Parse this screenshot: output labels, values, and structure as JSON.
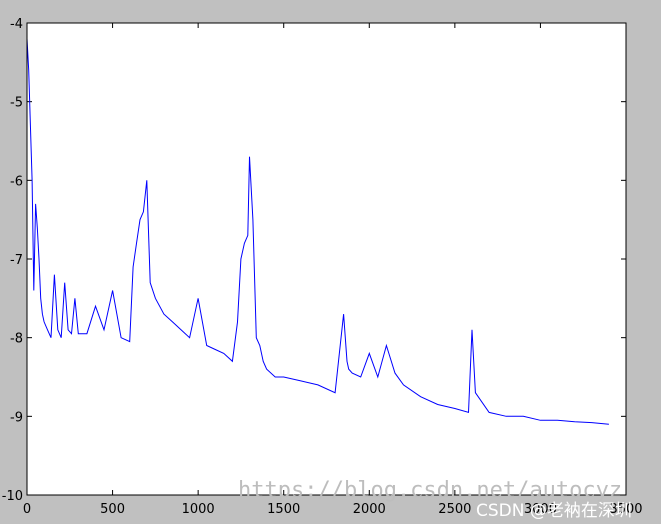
{
  "chart_data": {
    "type": "line",
    "xlim": [
      0,
      3500
    ],
    "ylim": [
      -10,
      -4
    ],
    "xticks": [
      0,
      500,
      1000,
      1500,
      2000,
      2500,
      3000,
      3500
    ],
    "yticks": [
      -4,
      -5,
      -6,
      -7,
      -8,
      -9,
      -10
    ],
    "xtick_labels": [
      "0",
      "500",
      "1000",
      "1500",
      "2000",
      "2500",
      "3000",
      "3500"
    ],
    "ytick_labels": [
      "-4",
      "-5",
      "-6",
      "-7",
      "-8",
      "-9",
      "-10"
    ],
    "grid": false,
    "legend": "none",
    "series_color": "#0000ff",
    "series": [
      {
        "x": [
          0,
          10,
          20,
          30,
          40,
          50,
          60,
          70,
          80,
          90,
          100,
          120,
          140,
          160,
          180,
          200,
          220,
          240,
          260,
          280,
          300,
          350,
          400,
          450,
          500,
          550,
          600,
          620,
          640,
          660,
          680,
          700,
          720,
          750,
          800,
          850,
          900,
          950,
          1000,
          1050,
          1100,
          1150,
          1200,
          1230,
          1250,
          1270,
          1290,
          1300,
          1320,
          1340,
          1360,
          1380,
          1400,
          1450,
          1500,
          1600,
          1700,
          1800,
          1850,
          1870,
          1880,
          1900,
          1950,
          2000,
          2050,
          2100,
          2150,
          2200,
          2300,
          2400,
          2500,
          2580,
          2600,
          2620,
          2700,
          2800,
          2900,
          3000,
          3100,
          3200,
          3300,
          3400
        ],
        "y": [
          -4.2,
          -4.6,
          -5.3,
          -6.0,
          -7.4,
          -6.3,
          -6.6,
          -7.0,
          -7.5,
          -7.7,
          -7.8,
          -7.9,
          -8.0,
          -7.2,
          -7.9,
          -8.0,
          -7.3,
          -7.9,
          -7.95,
          -7.5,
          -7.95,
          -7.95,
          -7.6,
          -7.9,
          -7.4,
          -8.0,
          -8.05,
          -7.1,
          -6.8,
          -6.5,
          -6.4,
          -6.0,
          -7.3,
          -7.5,
          -7.7,
          -7.8,
          -7.9,
          -8.0,
          -7.5,
          -8.1,
          -8.15,
          -8.2,
          -8.3,
          -7.8,
          -7.0,
          -6.8,
          -6.7,
          -5.7,
          -6.5,
          -8.0,
          -8.1,
          -8.3,
          -8.4,
          -8.5,
          -8.5,
          -8.55,
          -8.6,
          -8.7,
          -7.7,
          -8.3,
          -8.4,
          -8.45,
          -8.5,
          -8.2,
          -8.5,
          -8.1,
          -8.45,
          -8.6,
          -8.75,
          -8.85,
          -8.9,
          -8.95,
          -7.9,
          -8.7,
          -8.95,
          -9.0,
          -9.0,
          -9.05,
          -9.05,
          -9.07,
          -9.08,
          -9.1
        ]
      }
    ]
  },
  "watermark": {
    "text": "https://blog.csdn.net/autocyz",
    "badge": "CSDN @老衲在深圳"
  }
}
